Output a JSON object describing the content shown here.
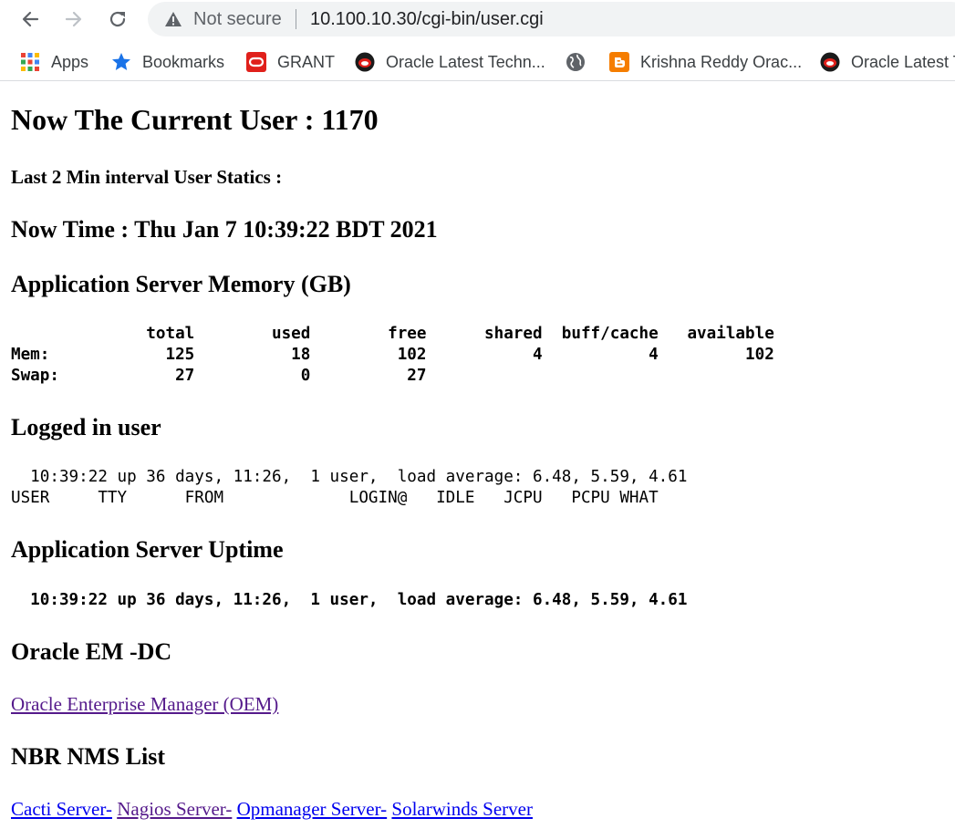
{
  "browser": {
    "not_secure_label": "Not secure",
    "url": "10.100.10.30/cgi-bin/user.cgi",
    "bookmarks": [
      {
        "label": "Apps",
        "icon": "apps-grid-icon"
      },
      {
        "label": "Bookmarks",
        "icon": "star-icon"
      },
      {
        "label": "GRANT",
        "icon": "oracle-icon"
      },
      {
        "label": "Oracle Latest Techn...",
        "icon": "oracle-mask-icon"
      },
      {
        "label": "",
        "icon": "globe-icon"
      },
      {
        "label": "Krishna Reddy Orac...",
        "icon": "blogger-icon"
      },
      {
        "label": "Oracle Latest T",
        "icon": "oracle-mask-icon"
      }
    ]
  },
  "page": {
    "current_user_heading": "Now The Current User : 1170",
    "interval_heading": "Last 2 Min interval User Statics :",
    "now_time_heading": "Now Time : Thu Jan 7 10:39:22 BDT 2021",
    "memory_heading": "Application Server Memory (GB)",
    "memory_table": "              total        used        free      shared  buff/cache   available\nMem:            125          18         102           4           4         102\nSwap:            27           0          27",
    "logged_heading": "Logged in user",
    "logged_block": "  10:39:22 up 36 days, 11:26,  1 user,  load average: 6.48, 5.59, 4.61\nUSER     TTY      FROM             LOGIN@   IDLE   JCPU   PCPU WHAT",
    "uptime_heading": "Application Server Uptime",
    "uptime_block": "  10:39:22 up 36 days, 11:26,  1 user,  load average: 6.48, 5.59, 4.61",
    "oem_heading": "Oracle EM -DC",
    "oem_link": "Oracle Enterprise Manager (OEM)",
    "nms_heading": "NBR NMS List",
    "nms_links": [
      "Cacti Server-",
      "Nagios Server-",
      "Opmanager Server-",
      "Solarwinds Server"
    ]
  },
  "colors": {
    "link_unvisited": "#0000ee",
    "link_visited": "#551a8b",
    "warning_icon": "#5f6368",
    "star": "#1a73e8",
    "oracle_red": "#e0201b",
    "blogger_orange": "#f57d00"
  }
}
